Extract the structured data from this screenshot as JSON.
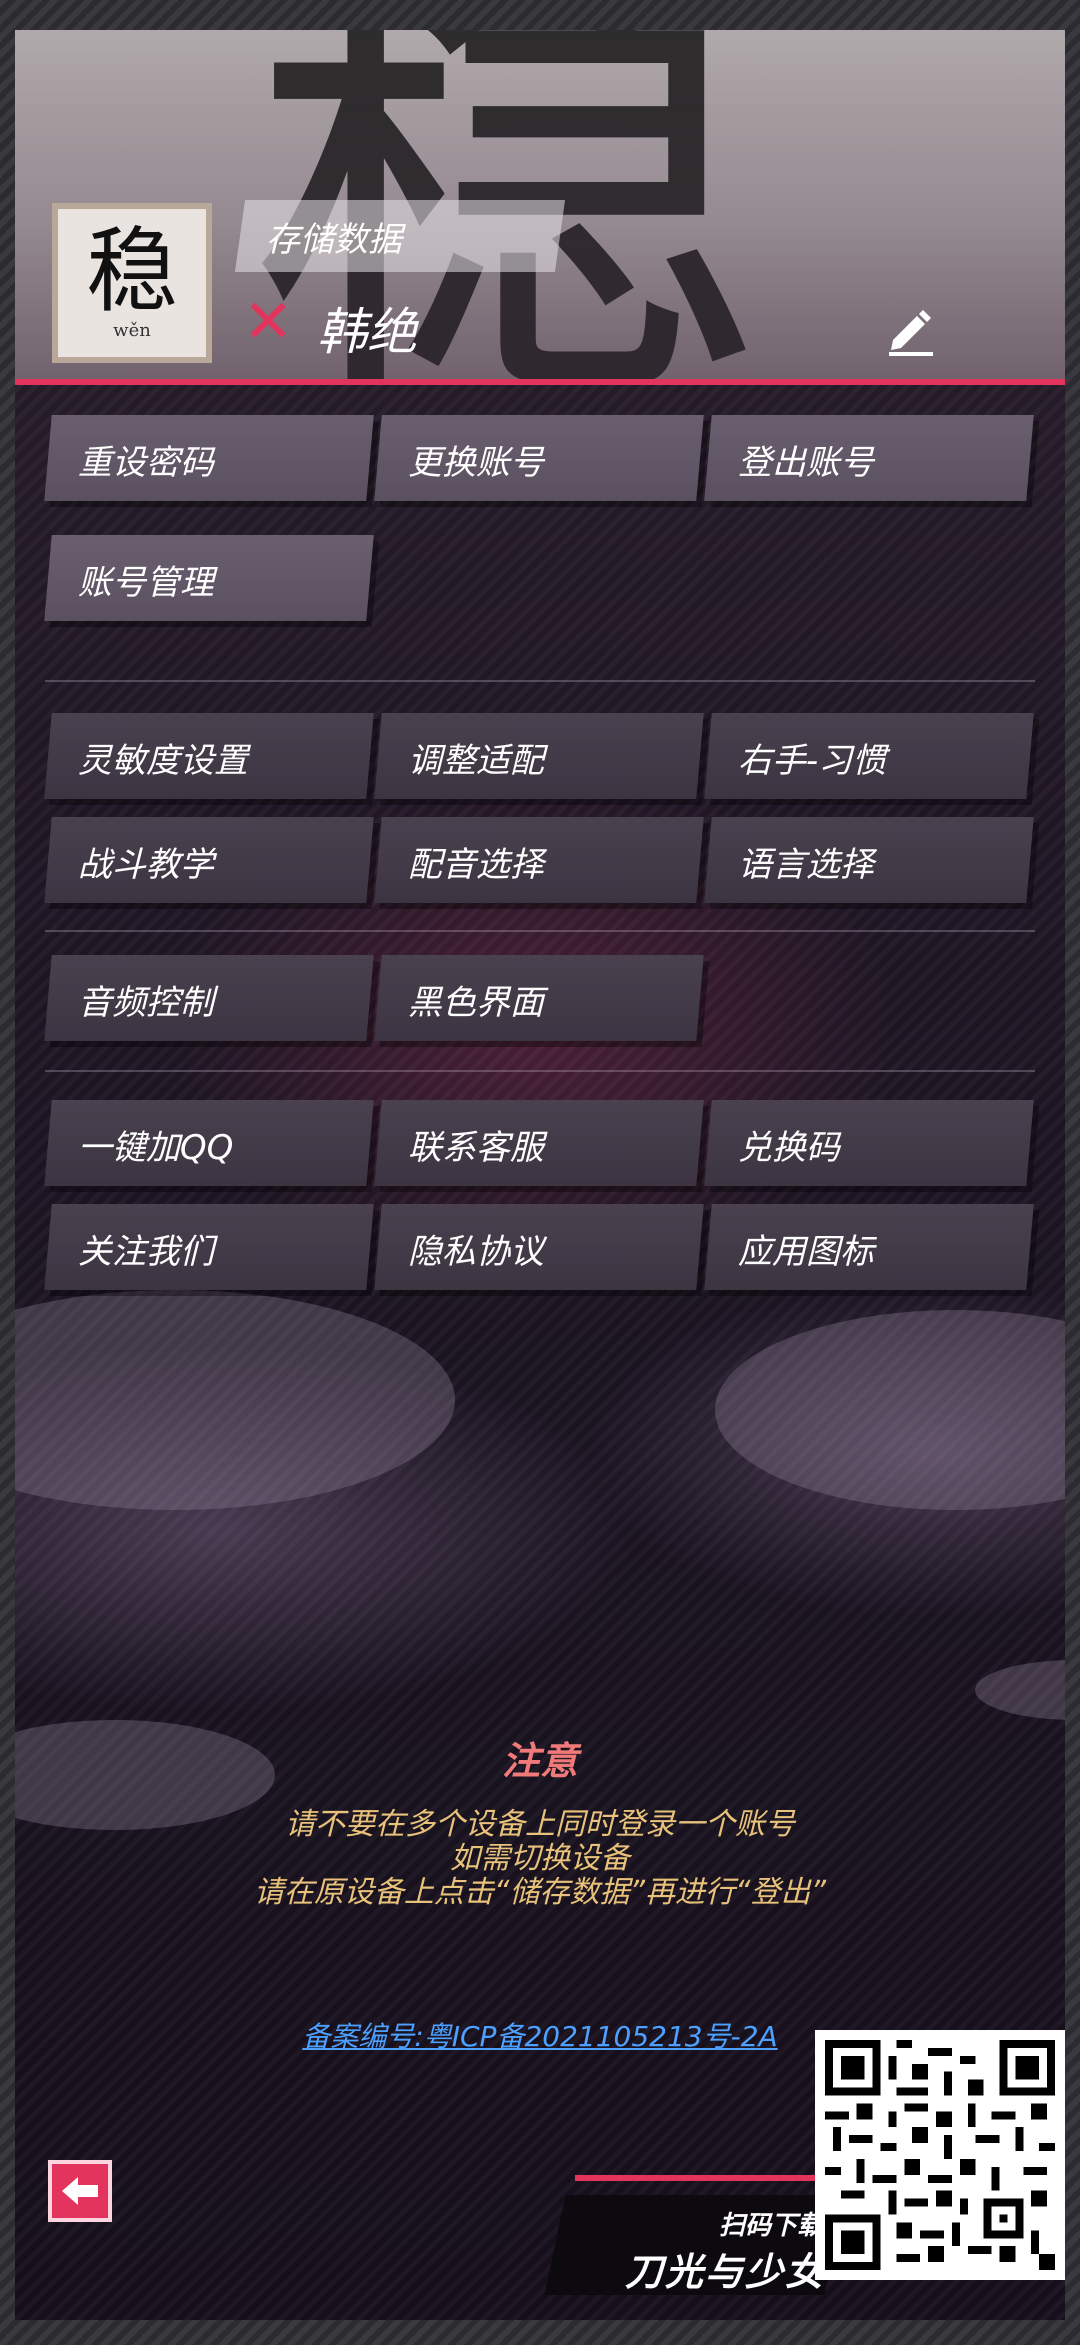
{
  "header": {
    "save_tag": "存储数据",
    "status_icon": "close-x-icon",
    "username": "韩绝",
    "avatar": {
      "hanzi": "稳",
      "pinyin": "wěn"
    },
    "background_glyph": "稳"
  },
  "account_buttons": [
    {
      "label": "重设密码"
    },
    {
      "label": "更换账号"
    },
    {
      "label": "登出账号"
    },
    {
      "label": "账号管理"
    }
  ],
  "settings_buttons": [
    {
      "label": "灵敏度设置"
    },
    {
      "label": "调整适配"
    },
    {
      "label": "右手-习惯"
    },
    {
      "label": "战斗教学"
    },
    {
      "label": "配音选择"
    },
    {
      "label": "语言选择"
    }
  ],
  "media_buttons": [
    {
      "label": "音频控制"
    },
    {
      "label": "黑色界面"
    }
  ],
  "social_buttons": [
    {
      "label": "一键加QQ"
    },
    {
      "label": "联系客服"
    },
    {
      "label": "兑换码"
    },
    {
      "label": "关注我们"
    },
    {
      "label": "隐私协议"
    },
    {
      "label": "应用图标"
    }
  ],
  "notice": {
    "title": "注意",
    "lines": [
      "请不要在多个设备上同时登录一个账号",
      "如需切换设备",
      "请在原设备上点击“储存数据”再进行“登出”"
    ]
  },
  "icp": "备案编号:粤ICP备2021105213号-2A",
  "promo": {
    "scan_label": "扫码下载",
    "game_title": "刀光与少女"
  },
  "colors": {
    "accent": "#e2345c",
    "notice_text": "#e8c27a",
    "notice_title": "#f07a7a",
    "link": "#4da0ff"
  }
}
